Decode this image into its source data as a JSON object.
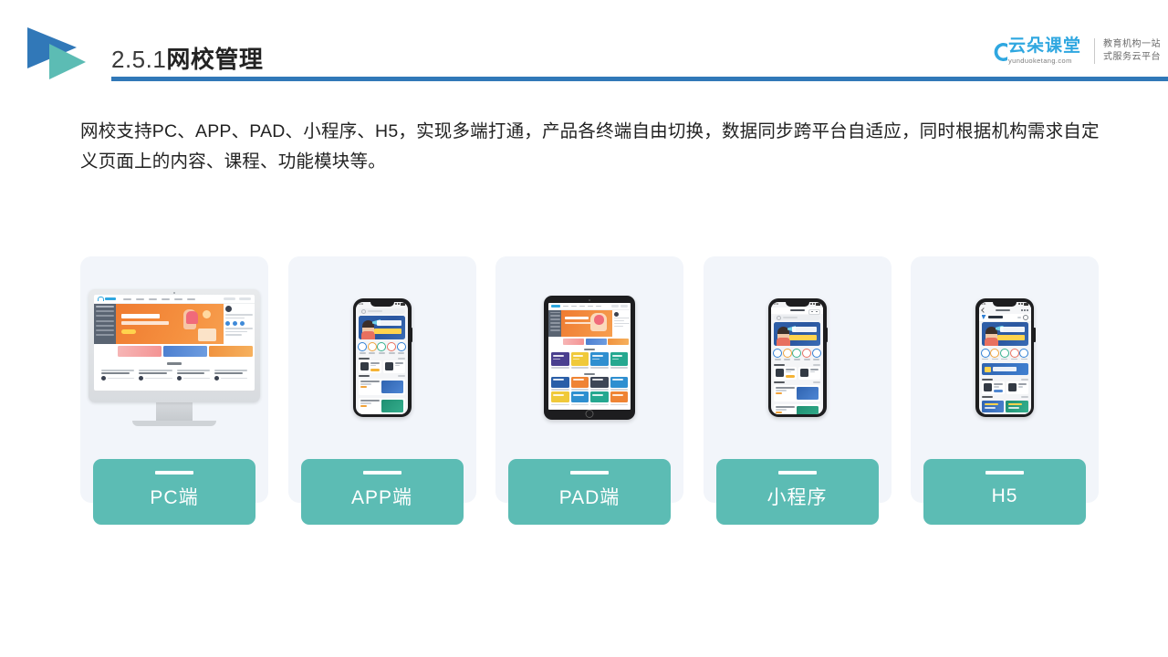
{
  "header": {
    "title_number": "2.5.1",
    "title_text": "网校管理",
    "rule_color": "#3178B8",
    "logo_colors": {
      "primary": "#3178B8",
      "secondary": "#5CBCB4"
    }
  },
  "brand": {
    "name_cn": "云朵课堂",
    "url": "yunduoketang.com",
    "tagline_line1": "教育机构一站",
    "tagline_line2": "式服务云平台",
    "accent_color": "#2FA7E0"
  },
  "body": {
    "paragraph": "网校支持PC、APP、PAD、小程序、H5，实现多端打通，产品各终端自由切换，数据同步跨平台自适应，同时根据机构需求自定义页面上的内容、课程、功能模块等。"
  },
  "cards": {
    "label_color": "#5CBCB4",
    "panel_color": "#F2F5FA",
    "items": [
      {
        "label": "PC端",
        "device": "desktop-monitor"
      },
      {
        "label": "APP端",
        "device": "smartphone"
      },
      {
        "label": "PAD端",
        "device": "tablet"
      },
      {
        "label": "小程序",
        "device": "smartphone-miniprogram"
      },
      {
        "label": "H5",
        "device": "smartphone-browser"
      }
    ]
  }
}
